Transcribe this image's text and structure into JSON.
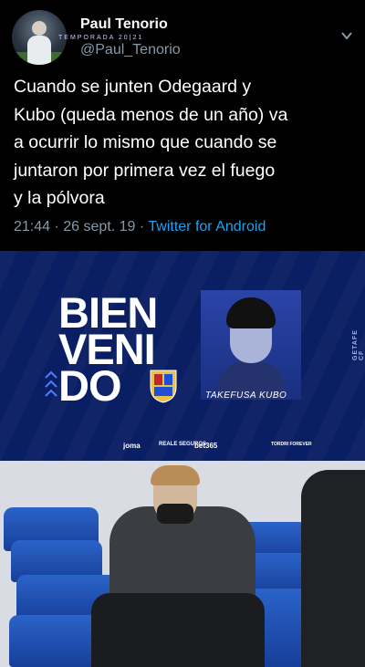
{
  "tweet": {
    "display_name": "Paul Tenorio",
    "handle": "@Paul_Tenorio",
    "text_lines": [
      "Cuando se junten Odegaard y",
      "Kubo (queda menos de un año) va",
      "a ocurrir lo mismo que cuando se",
      "juntaron por primera vez el fuego",
      "y la pólvora"
    ],
    "time": "21:44",
    "date": "26 sept. 19",
    "source": "Twitter for Android",
    "icons": [
      "avatar-photo",
      "chevron-down-icon"
    ]
  },
  "banner": {
    "temporada": "TEMPORADA 20|21",
    "big_lines": [
      "BIEN",
      "VENI",
      "DO"
    ],
    "player_name": "TAKEFUSA KUBO",
    "side_text": "GETAFE CF",
    "sponsors": [
      "joma",
      "REALE SEGUROS",
      "bet365",
      "TORDRI FOREVER"
    ],
    "colors": {
      "background": "#0a1f63",
      "accent": "#1f4fd6"
    }
  },
  "colors": {
    "link": "#1da1f2",
    "muted": "#8899a6",
    "text": "#ffffff"
  }
}
